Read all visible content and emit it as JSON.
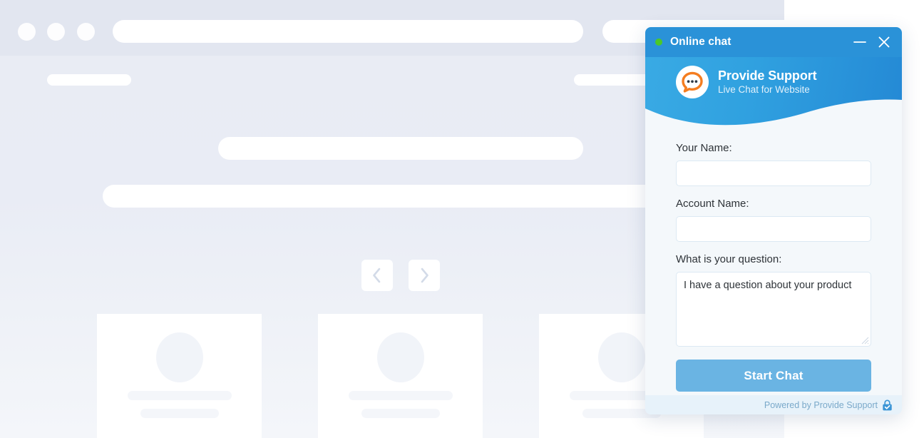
{
  "background": {
    "name": "website-wireframe-placeholder",
    "browser_dots": [
      "dot-1",
      "dot-2",
      "dot-3"
    ],
    "address_bar": "",
    "nav_placeholder": "",
    "hero_placeholder": "",
    "carousel": {
      "prev_icon": "chevron-left-icon",
      "next_icon": "chevron-right-icon"
    },
    "cards": [
      {
        "avatar": "avatar-placeholder",
        "line1": "",
        "line2": ""
      },
      {
        "avatar": "avatar-placeholder",
        "line1": "",
        "line2": ""
      },
      {
        "avatar": "avatar-placeholder",
        "line1": "",
        "line2": ""
      }
    ]
  },
  "chat_widget": {
    "titlebar": {
      "status": "online",
      "status_color": "#4bc828",
      "title": "Online chat",
      "minimize_icon": "minimize-icon",
      "close_icon": "close-icon"
    },
    "banner": {
      "logo_icon": "speech-bubble-logo-icon",
      "brand_name": "Provide Support",
      "brand_tagline": "Live Chat for Website",
      "accent_color": "#2a92d8",
      "logo_accent_color": "#f47d20"
    },
    "form": {
      "fields": [
        {
          "name": "your-name",
          "label": "Your Name:",
          "value": "",
          "placeholder": ""
        },
        {
          "name": "account-name",
          "label": "Account Name:",
          "value": "",
          "placeholder": ""
        }
      ],
      "question": {
        "name": "question",
        "label": "What is your question:",
        "value": "I have a question about your product",
        "placeholder": ""
      },
      "submit_label": "Start Chat",
      "submit_color": "#6ab4e3"
    },
    "footer": {
      "text": "Powered by Provide Support",
      "lock_icon": "lock-check-icon"
    }
  }
}
